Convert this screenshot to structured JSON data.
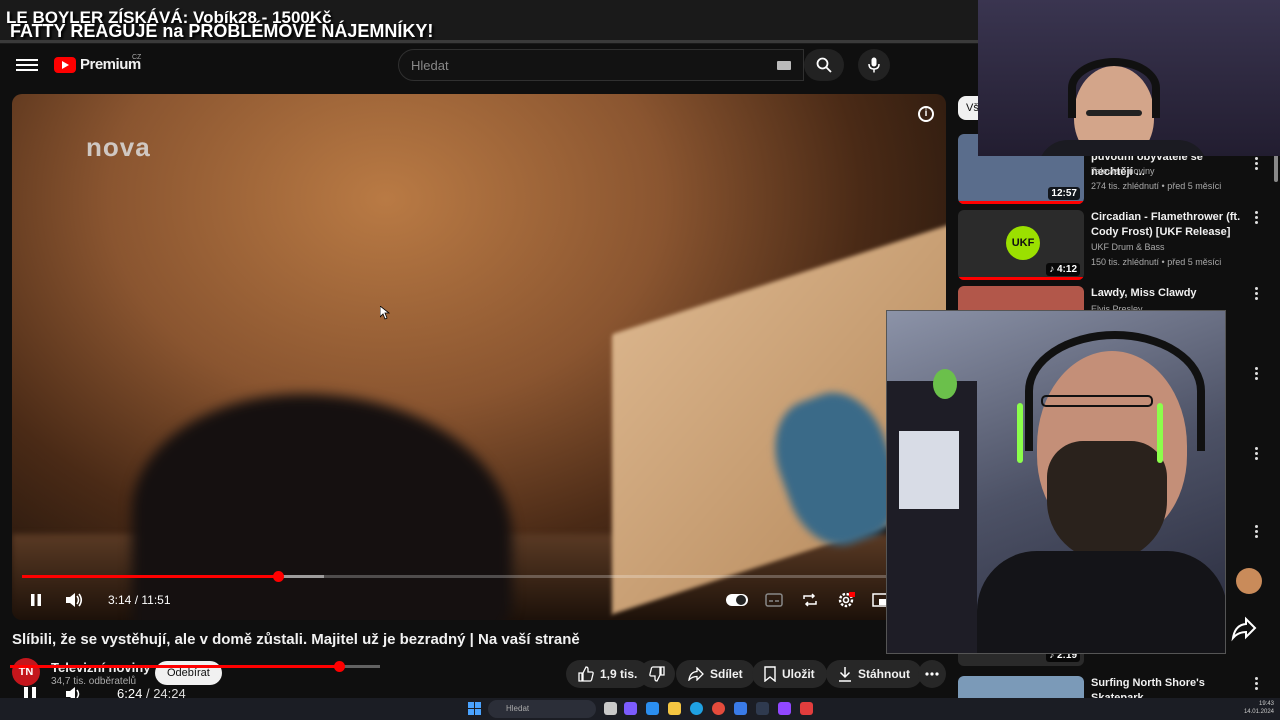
{
  "overlay": {
    "line1": "LE BOYLER ZÍSKÁVÁ: Vobík28 - 1500Kč",
    "line2": "FATTY REAGUJE na PROBLÉMOVÉ NÁJEMNÍKY!"
  },
  "header": {
    "brand": "Premium",
    "brand_region": "CZ",
    "search_placeholder": "Hledat"
  },
  "player": {
    "channel_watermark": "nova",
    "time_current": "3:14",
    "time_total": "11:51",
    "progress_played": 0.28,
    "progress_buffered": 0.33
  },
  "video": {
    "title": "Slíbili, že se vystěhují, ale v domě zůstali. Majitel už je bezradný | Na vaší straně",
    "channel": {
      "avatar_text": "TN",
      "name": "Televizní noviny",
      "subscribers": "34,7 tis. odběratelů",
      "subscribe_label": "Odebírat"
    },
    "actions": {
      "likes": "1,9 tis.",
      "share": "Sdílet",
      "save": "Uložit",
      "download": "Stáhnout"
    }
  },
  "outer_player": {
    "time_current": "6:24",
    "separator": "/",
    "time_total": "24:24",
    "progress_played": 0.89
  },
  "sidebar": {
    "chip": "Vš",
    "items": [
      {
        "title": "původní obyvatelé se nechtějí ...",
        "channel": "Televizní noviny",
        "meta": "274 tis. zhlédnutí • před 5 měsíci",
        "duration": "12:57",
        "thumb_color": "#5a6d8c"
      },
      {
        "title": "Circadian - Flamethrower (ft. Cody Frost) [UKF Release]",
        "channel": "UKF Drum & Bass",
        "meta": "150 tis. zhlédnutí • před 5 měsíci",
        "duration": "4:12",
        "thumb_color": "#2b2b2b"
      },
      {
        "title": "Lawdy, Miss Clawdy",
        "channel": "Elvis Presley",
        "meta": "",
        "duration": "",
        "thumb_color": "#b2574a"
      },
      {
        "title": "",
        "channel": "",
        "meta": "",
        "duration": "2:19",
        "thumb_color": "#2a2a2a"
      },
      {
        "title": "Surfing North Shore's Skatepark",
        "channel": "",
        "meta": "",
        "duration": "",
        "thumb_color": "#7b9ab8"
      }
    ]
  },
  "taskbar": {
    "search_label": "Hledat",
    "clock_time": "19:43",
    "clock_date": "14.01.2024"
  }
}
